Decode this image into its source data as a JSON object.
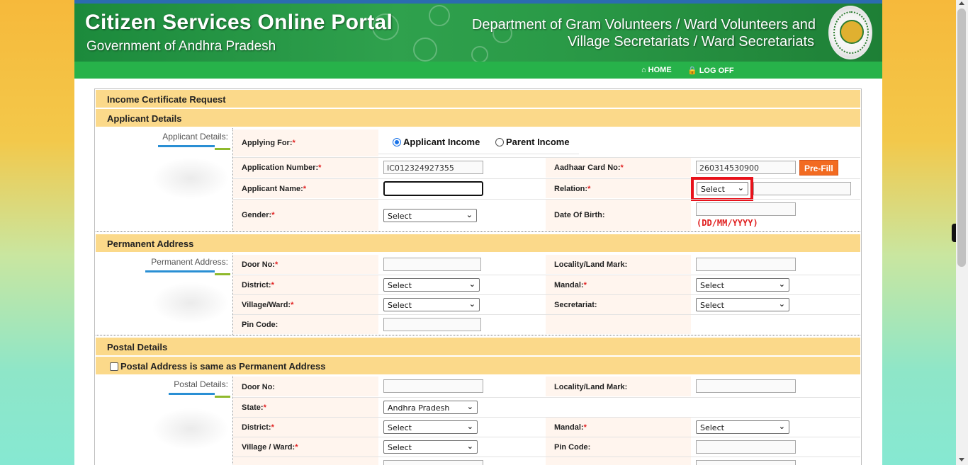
{
  "header": {
    "title": "Citizen Services Online Portal",
    "subtitle": "Government of Andhra Pradesh",
    "department_line1": "Department of Gram Volunteers / Ward Volunteers and",
    "department_line2": "Village Secretariats / Ward Secretariats",
    "emblem": "andhra-pradesh-emblem"
  },
  "nav": {
    "home_label": "HOME",
    "home_icon": "home-icon",
    "logoff_label": "LOG OFF",
    "logoff_icon": "lock-icon"
  },
  "form": {
    "title": "Income Certificate Request",
    "applicant_section": {
      "heading": "Applicant Details",
      "side_label": "Applicant Details:",
      "applying_for_label": "Applying For:",
      "applying_for_options": [
        "Applicant Income",
        "Parent Income"
      ],
      "applying_for_selected": "Applicant Income",
      "application_number_label": "Application Number:",
      "application_number_value": "IC012324927355",
      "aadhaar_label": "Aadhaar Card No:",
      "aadhaar_value": "260314530900",
      "prefill_button": "Pre-Fill",
      "applicant_name_label": "Applicant Name:",
      "applicant_name_value": "",
      "relation_label": "Relation:",
      "relation_value": "Select",
      "relation_name_value": "",
      "gender_label": "Gender:",
      "gender_value": "Select",
      "dob_label": "Date Of Birth:",
      "dob_value": "",
      "dob_hint": "(DD/MM/YYYY)"
    },
    "permanent_section": {
      "heading": "Permanent Address",
      "side_label": "Permanent Address:",
      "door_no_label": "Door No:",
      "door_no_value": "",
      "locality_label": "Locality/Land Mark:",
      "locality_value": "",
      "district_label": "District:",
      "district_value": "Select",
      "mandal_label": "Mandal:",
      "mandal_value": "Select",
      "village_label": "Village/Ward:",
      "village_value": "Select",
      "secretariat_label": "Secretariat:",
      "secretariat_value": "Select",
      "pin_label": "Pin Code:",
      "pin_value": ""
    },
    "postal_section": {
      "heading": "Postal Details",
      "same_as_permanent_label": "Postal Address is same as Permanent Address",
      "same_as_permanent_checked": false,
      "side_label": "Postal Details:",
      "door_no_label": "Door No:",
      "door_no_value": "",
      "locality_label": "Locality/Land Mark:",
      "locality_value": "",
      "state_label": "State:",
      "state_value": "Andhra Pradesh",
      "district_label": "District:",
      "district_value": "Select",
      "mandal_label": "Mandal:",
      "mandal_value": "Select",
      "village_label": "Village / Ward:",
      "village_value": "Select",
      "pin_label": "Pin Code:",
      "pin_value": ""
    }
  },
  "colors": {
    "banner_green": "#2fa14d",
    "nav_green": "#27b24a",
    "section_header": "#fbd98a",
    "label_bg": "#fff5ee",
    "required": "#e01f1f",
    "prefill_button": "#f26b21",
    "highlight_box": "#e8121b"
  }
}
